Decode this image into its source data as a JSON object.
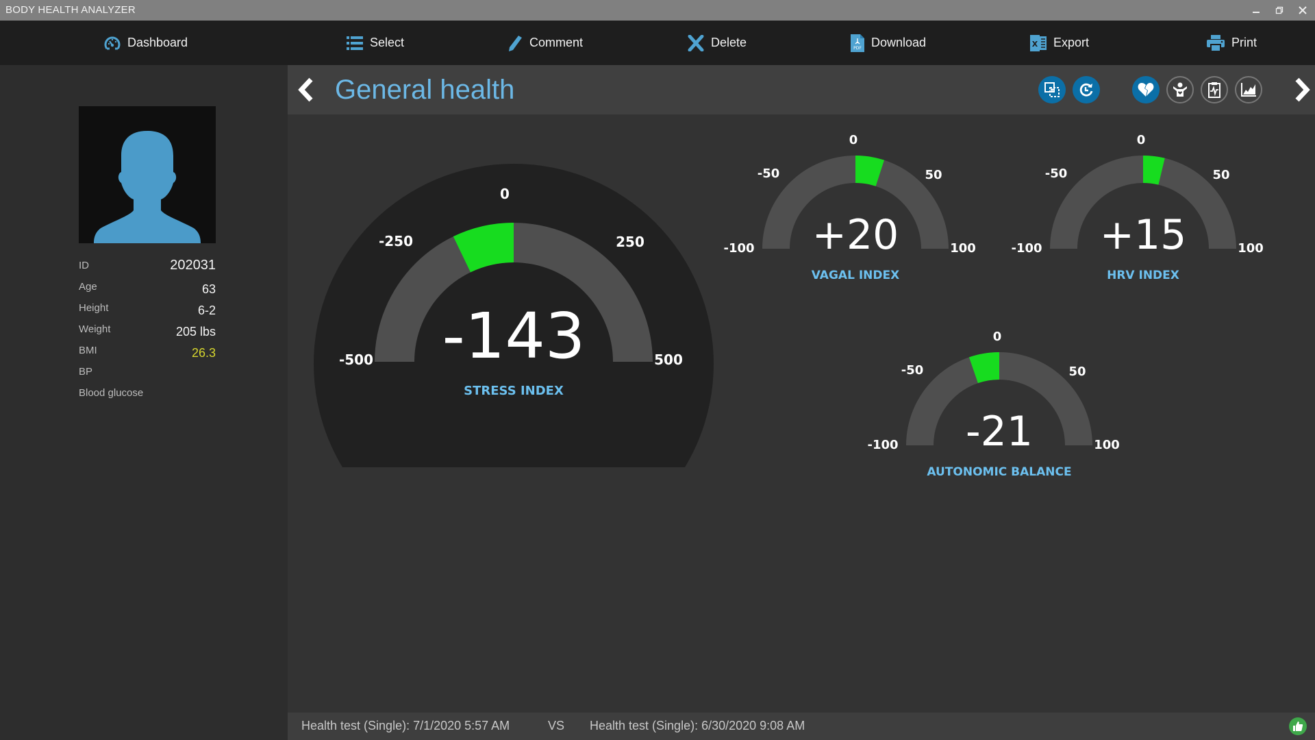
{
  "window": {
    "title": "BODY HEALTH ANALYZER",
    "controls": {
      "minimize": "–",
      "restore": "❐",
      "close": "✕"
    }
  },
  "toolbar": {
    "dashboard": {
      "label": "Dashboard",
      "icon": "dashboard-icon"
    },
    "select": {
      "label": "Select",
      "icon": "list-icon"
    },
    "comment": {
      "label": "Comment",
      "icon": "pencil-icon"
    },
    "delete": {
      "label": "Delete",
      "icon": "x-icon"
    },
    "download": {
      "label": "Download",
      "icon": "pdf-icon"
    },
    "export": {
      "label": "Export",
      "icon": "excel-icon"
    },
    "print": {
      "label": "Print",
      "icon": "printer-icon"
    }
  },
  "patient": {
    "fields": [
      {
        "label": "ID",
        "value": "202031"
      },
      {
        "label": "Age",
        "value": "63"
      },
      {
        "label": "Height",
        "value": "6-2"
      },
      {
        "label": "Weight",
        "value": "205 lbs"
      },
      {
        "label": "BMI",
        "value": "26.3"
      },
      {
        "label": "BP",
        "value": ""
      },
      {
        "label": "Blood glucose",
        "value": ""
      }
    ],
    "bmi_color": "#d6d62e"
  },
  "header": {
    "title": "General health",
    "buttons": [
      {
        "name": "compare-icon",
        "style": "filled"
      },
      {
        "name": "history-icon",
        "style": "filled"
      },
      {
        "name": "broken-heart-icon",
        "style": "filled"
      },
      {
        "name": "person-heart-icon",
        "style": "outline"
      },
      {
        "name": "clipboard-pulse-icon",
        "style": "outline"
      },
      {
        "name": "area-chart-icon",
        "style": "outline"
      }
    ]
  },
  "colors": {
    "accent": "#6cb8e6",
    "gauge_fill": "#17dc1f",
    "gauge_track": "#4f4f4f",
    "button_blue": "#0b6fa7"
  },
  "chart_data": [
    {
      "type": "gauge",
      "title": "STRESS INDEX",
      "value": -143,
      "display": "-143",
      "range": [
        -500,
        500
      ],
      "ticks": [
        -500,
        -250,
        0,
        250,
        500
      ],
      "tick_labels": [
        "-500",
        "-250",
        "0",
        "250",
        "500"
      ]
    },
    {
      "type": "gauge",
      "title": "VAGAL INDEX",
      "value": 20,
      "display": "+20",
      "range": [
        -100,
        100
      ],
      "ticks": [
        -100,
        -50,
        0,
        50,
        100
      ],
      "tick_labels": [
        "-100",
        "-50",
        "0",
        "50",
        "100"
      ]
    },
    {
      "type": "gauge",
      "title": "HRV INDEX",
      "value": 15,
      "display": "+15",
      "range": [
        -100,
        100
      ],
      "ticks": [
        -100,
        -50,
        0,
        50,
        100
      ],
      "tick_labels": [
        "-100",
        "-50",
        "0",
        "50",
        "100"
      ]
    },
    {
      "type": "gauge",
      "title": "AUTONOMIC BALANCE",
      "value": -21,
      "display": "-21",
      "range": [
        -100,
        100
      ],
      "ticks": [
        -100,
        -50,
        0,
        50,
        100
      ],
      "tick_labels": [
        "-100",
        "-50",
        "0",
        "50",
        "100"
      ]
    }
  ],
  "status": {
    "left": "Health test (Single):  7/1/2020 5:57 AM",
    "vs": "VS",
    "right": "Health test (Single):  6/30/2020 9:08 AM",
    "status_icon": "thumbs-up-icon"
  }
}
